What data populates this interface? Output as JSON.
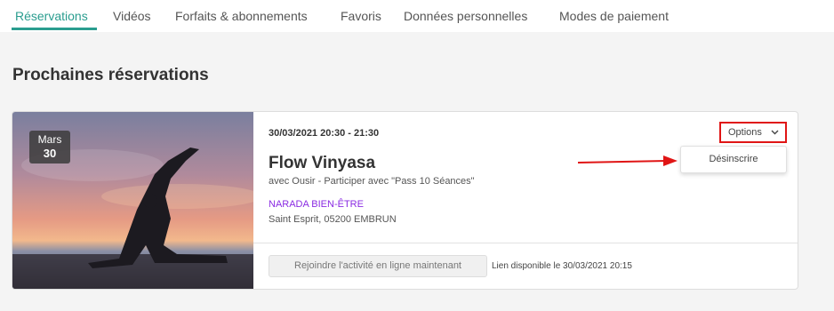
{
  "tabs": [
    {
      "label": "Réservations",
      "active": true
    },
    {
      "label": "Vidéos",
      "active": false
    },
    {
      "label": "Forfaits & abonnements",
      "active": false
    },
    {
      "label": "Favoris",
      "active": false
    },
    {
      "label": "Données personnelles",
      "active": false
    },
    {
      "label": "Modes de paiement",
      "active": false
    }
  ],
  "section": {
    "title": "Prochaines réservations"
  },
  "booking": {
    "date_badge": {
      "month": "Mars",
      "day": "30"
    },
    "datetime": "30/03/2021 20:30 - 21:30",
    "title": "Flow Vinyasa",
    "subtitle": "avec Ousir - Participer avec \"Pass 10 Séances\"",
    "studio": "NARADA BIEN-ÊTRE",
    "address": "Saint Esprit, 05200 EMBRUN",
    "join_button": "Rejoindre l'activité en ligne maintenant",
    "link_note": "Lien disponible le 30/03/2021 20:15",
    "options_label": "Options",
    "dropdown": [
      {
        "label": "Désinscrire"
      }
    ]
  },
  "colors": {
    "accent": "#2a9d8f",
    "studio": "#8a2be2",
    "annotation": "#e01515"
  }
}
